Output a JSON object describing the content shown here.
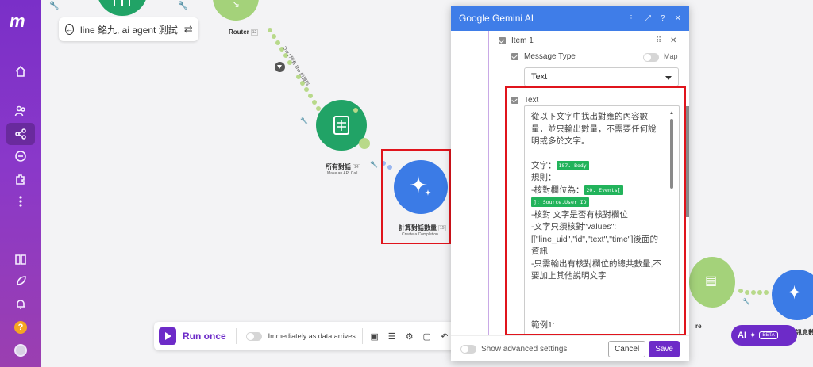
{
  "sidebar": {
    "logo": "m",
    "help_label": "?"
  },
  "search": {
    "value": "line 銘九, ai agent 測試"
  },
  "nodes": {
    "router": {
      "label": "Router",
      "badge": "12"
    },
    "sheets": {
      "label": "所有對話",
      "badge": "14",
      "sub": "Make an API Call"
    },
    "gemini": {
      "label": "計算對話數量",
      "badge": "15",
      "sub": "Create a Completion"
    },
    "partial_right": {
      "label": "re",
      "label2": "訊息數"
    },
    "link_label": "2nd  | 所有 line 的資料"
  },
  "toolbar": {
    "run_label": "Run once",
    "immediately_label": "Immediately as data arrives"
  },
  "ai_pill": {
    "label": "AI",
    "beta": "BETA"
  },
  "panel": {
    "title": "Google Gemini AI",
    "item_label": "Item 1",
    "message_type_label": "Message Type",
    "map_label": "Map",
    "message_type_value": "Text",
    "text_label": "Text",
    "text_content": {
      "line1": "從以下文字中找出對應的內容數量，並只輸出數量，不需要任何說明或多於文字。",
      "line2_prefix": "文字：",
      "tag_body": "187. Body",
      "line3": "規則：",
      "line4_prefix": "-核對欄位為：",
      "tag_events": "20. Events[",
      "tag_source": "]: Source.User ID",
      "line5": "-核對 文字是否有核對欄位",
      "line6": "-文字只須核對\"values\":[[\"line_uid\",\"id\",\"text\",\"time\"]後面的資訊",
      "line7": "-只需輸出有核對欄位的總共數量,不要加上其他說明文字",
      "line8": "範例1:"
    },
    "advanced_label": "Show advanced settings",
    "cancel_label": "Cancel",
    "save_label": "Save"
  },
  "colors": {
    "brand": "#6d2bc8",
    "header": "#3f7de8",
    "highlight": "#e0141c",
    "sheets_green": "#21a366",
    "gemini_blue": "#3b7be6"
  }
}
